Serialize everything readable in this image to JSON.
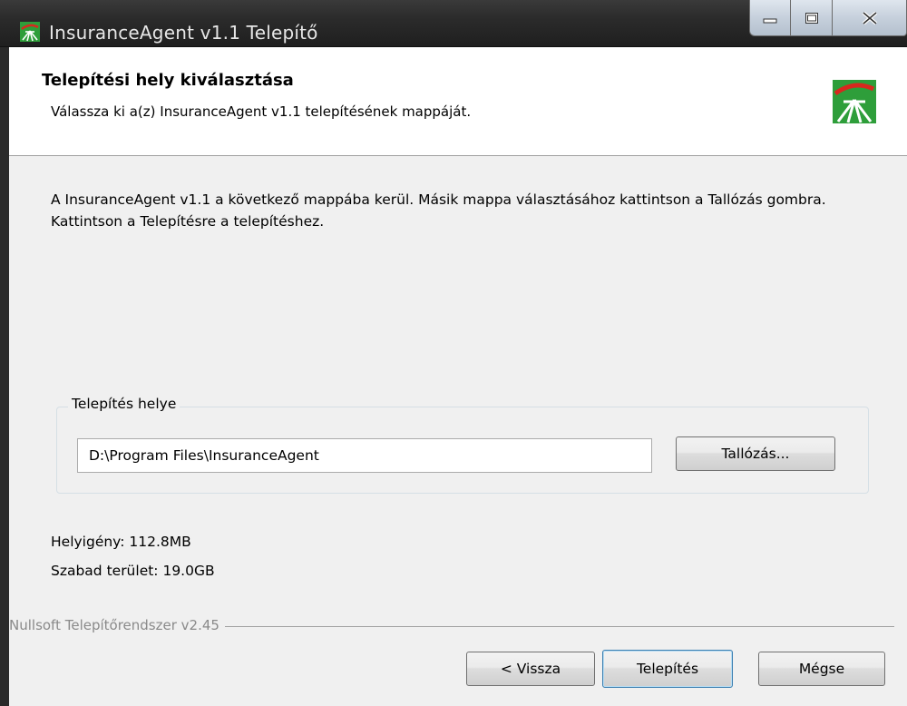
{
  "window": {
    "title": "InsuranceAgent v1.1 Telepítő"
  },
  "header": {
    "heading": "Telepítési hely kiválasztása",
    "subheading": "Válassza ki a(z) InsuranceAgent v1.1 telepítésének mappáját."
  },
  "content": {
    "instructions": "A InsuranceAgent v1.1 a következő mappába kerül. Másik mappa választásához kattintson a Tallózás gombra. Kattintson a Telepítésre a telepítéshez."
  },
  "install_location": {
    "group_label": "Telepítés helye",
    "path_value": "D:\\Program Files\\InsuranceAgent",
    "browse_label": "Tallózás..."
  },
  "space": {
    "required": "Helyigény: 112.8MB",
    "free": "Szabad terület: 19.0GB"
  },
  "footer": {
    "branding": "Nullsoft Telepítőrendszer v2.45",
    "back_label": "< Vissza",
    "install_label": "Telepítés",
    "cancel_label": "Mégse"
  },
  "icons": {
    "app_icon": "installer-logo-icon",
    "minimize": "minimize-icon",
    "maximize": "maximize-icon",
    "close": "close-icon"
  },
  "colors": {
    "logo_green": "#2e9e3a",
    "logo_red": "#d8281e",
    "titlebar": "#2b2b2b"
  }
}
